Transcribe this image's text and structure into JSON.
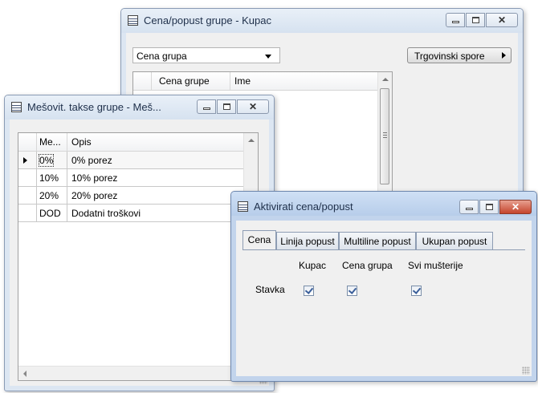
{
  "window_price": {
    "title": "Cena/popust grupe  - Kupac",
    "dropdown_value": "Cena grupa",
    "trade_button": "Trgovinski spore",
    "columns": [
      "Cena grupe",
      "Ime"
    ]
  },
  "window_tax": {
    "title": "Mešovit. takse grupe  - Meš...",
    "columns": [
      "Me...",
      "Opis"
    ],
    "rows": [
      {
        "code": "0%",
        "desc": "0% porez"
      },
      {
        "code": "10%",
        "desc": "10% porez"
      },
      {
        "code": "20%",
        "desc": "20% porez"
      },
      {
        "code": "DOD",
        "desc": "Dodatni troškovi"
      }
    ]
  },
  "window_activate": {
    "title": "Aktivirati cena/popust",
    "tabs": [
      "Cena",
      "Linija popust",
      "Multiline popust",
      "Ukupan popust"
    ],
    "selected_tab": "Cena",
    "col_headers": [
      "Kupac",
      "Cena grupa",
      "Svi mušterije"
    ],
    "row_label": "Stavka",
    "checks": [
      true,
      true,
      true
    ]
  },
  "colors": {
    "active_title": "#b7cdea",
    "inactive_title": "#d6e2f0",
    "close_active": "#c4442c"
  }
}
